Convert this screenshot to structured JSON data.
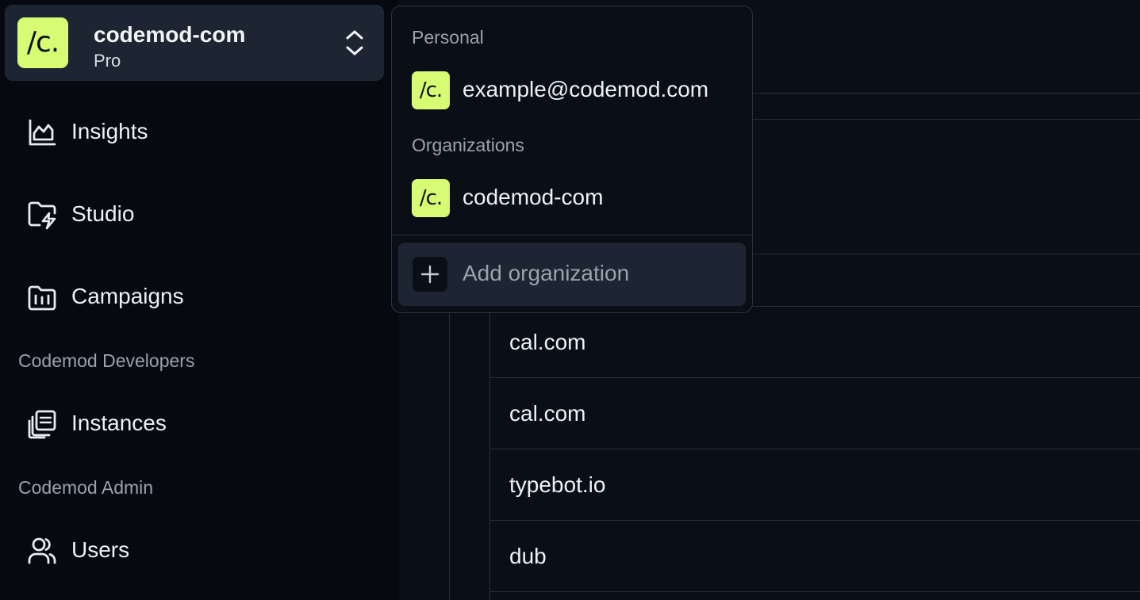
{
  "org_switcher": {
    "logo_text": "/c.",
    "name": "codemod-com",
    "plan": "Pro",
    "chevron_icon": "chevron-up-down-icon"
  },
  "nav": {
    "items": [
      {
        "label": "Insights",
        "icon": "chart-icon"
      },
      {
        "label": "Studio",
        "icon": "folder-bolt-icon"
      },
      {
        "label": "Campaigns",
        "icon": "folder-chart-icon"
      }
    ],
    "developers_section": "Codemod Developers",
    "developers_items": [
      {
        "label": "Instances",
        "icon": "instances-icon"
      }
    ],
    "admin_section": "Codemod Admin",
    "admin_items": [
      {
        "label": "Users",
        "icon": "users-icon"
      }
    ]
  },
  "dropdown": {
    "personal_section": "Personal",
    "personal_account": {
      "logo_text": "/c.",
      "label": "example@codemod.com"
    },
    "organizations_section": "Organizations",
    "organizations": [
      {
        "logo_text": "/c.",
        "label": "codemod-com"
      }
    ],
    "add_label": "Add organization",
    "add_icon": "plus-icon"
  },
  "table": {
    "rows": [
      "cal.com",
      "cal.com",
      "typebot.io",
      "dub"
    ]
  },
  "colors": {
    "accent": "#d7fb72",
    "background": "#060910",
    "panel": "#1d2533",
    "muted_text": "#9aa2ae"
  }
}
